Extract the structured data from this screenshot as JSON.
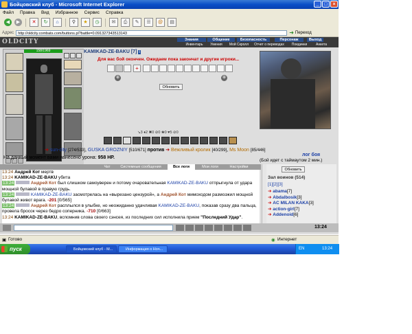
{
  "window": {
    "title": "Бойцовский клуб - Microsoft Internet Explorer",
    "min": "_",
    "max": "□",
    "close": "×"
  },
  "menu": [
    "Файл",
    "Правка",
    "Вид",
    "Избранное",
    "Сервис",
    "Справка"
  ],
  "address": {
    "label": "Адрес",
    "url": "http://oldcity.combats.com/buttons.pl?battle=0.091327343513143",
    "go": "Переход"
  },
  "game": {
    "logo": "OLDCITY",
    "nav_top": [
      "Знания",
      "Общение",
      "Безопасность",
      "Персонаж",
      "Выход"
    ],
    "nav_bottom": [
      "Инвентарь",
      "Умения",
      "Мой Скролл",
      "Отчет о переводах",
      "Поединки",
      "Анкета"
    ],
    "hp_left": "158/1969",
    "fighter": {
      "name": "KAMIKAD-ZE-BAKU",
      "level": "[7]"
    },
    "notice": "Для вас бой окончен. Ожидаем пока закончат и другие игроки...",
    "update_button": "Обновить",
    "stats_line": "↘3  ♦2  ✖0  ⊘0  ❀0  ♥5  ⊘0",
    "battle": {
      "team1": [
        {
          "name": "sun-city",
          "hp": "[274/533]"
        },
        {
          "name": "GUSKA GROZNIY",
          "hp": "[510/671]"
        }
      ],
      "versus": "против",
      "team2": [
        {
          "name": "Вежливый кролик",
          "hp": "[40/299]"
        },
        {
          "name": "Ms Moon",
          "hp": "[85/446]"
        }
      ]
    },
    "damage_prefix": "На данный момент вами нанесено урона:",
    "damage_value": "958 HP.",
    "battle_log": "лог боя",
    "timeout": "(Бой идет с таймаутом 2 мин.)"
  },
  "chat": {
    "tabs": [
      "Чат",
      "Системные сообщения",
      "Все логи",
      "Мои логи",
      "Настройки"
    ],
    "active_tab": "Все логи",
    "lines": [
      {
        "time": "13:24",
        "a": "Андрей Кот",
        "text": " мертв"
      },
      {
        "time": "13:24",
        "a": "KAMIKAD-ZE-BAKU",
        "text": " убита"
      },
      {
        "time": "13:24",
        "a": "Андрей Кот",
        "text": " был слишком самоуверен и потому очаровательная ",
        "b": "KAMIKAD-ZE-BAKU",
        "text2": " отпрыгнула от удара мощной булавой в правую грудь."
      },
      {
        "time": "13:24",
        "a": "KAMIKAD-ZE-BAKU",
        "text": " засмотрелась на «вырезано цензурой», а ",
        "b": "Андрей Кот",
        "text2": " мимоходом размозжил мощной булавой живот врага.",
        "dmg": "-201",
        "hp": "[0/565]"
      },
      {
        "time": "13:24",
        "a": "Андрей Кот",
        "text": " расплылся в улыбке, но неожиданно удачливая ",
        "b": "KAMIKAD-ZE-BAKU",
        "text2": ", показав сразу два пальца, провела бросок через бедро соперника.",
        "dmg": "-710",
        "hp": "[0/663]"
      },
      {
        "time": "13:24",
        "a": "KAMIKAD-ZE-BAKU",
        "text": ", вспомнив слова своего сэнсея, из последних сил исполнила прием ",
        "b": "\"Последний Удар\"",
        "text2": "."
      }
    ]
  },
  "side": {
    "update": "Обновить",
    "hall": "Зал воинов (514)",
    "pages": "[1][2][3]",
    "players": [
      {
        "name": "abama",
        "level": "[7]"
      },
      {
        "name": "Abdalbosik",
        "level": "[3]"
      },
      {
        "name": "AC MILAN KAKA",
        "level": "[3]"
      },
      {
        "name": "action-girl",
        "level": "[7]"
      },
      {
        "name": "Addenoid",
        "level": "[6]"
      }
    ]
  },
  "clock": "13:24",
  "status": {
    "left": "Готово",
    "right": "Интернет"
  },
  "taskbar": {
    "start": "пуск",
    "tasks": [
      "Бойцовский клуб - M...",
      "Информация о Ноч..."
    ],
    "lang": "EN",
    "time": "13:24"
  }
}
